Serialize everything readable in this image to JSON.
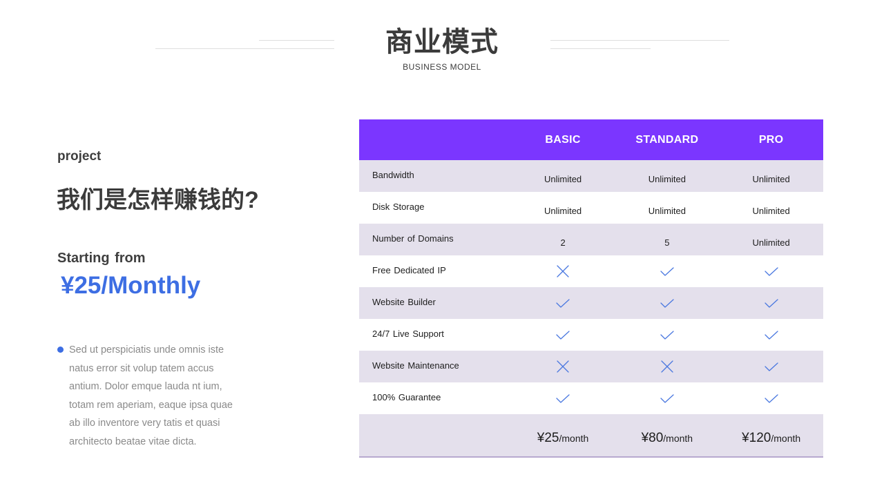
{
  "header": {
    "title": "商业模式",
    "subtitle": "BUSINESS  MODEL"
  },
  "left": {
    "project_label": "project",
    "heading": "我们是怎样赚钱的?",
    "starting_label": "Starting from",
    "price": "¥25/Monthly",
    "body": "Sed ut perspiciatis unde omnis iste natus error sit volup tatem accus antium. Dolor emque lauda nt ium, totam rem aperiam, eaque ipsa quae ab illo inventore very tatis et quasi architecto beatae vitae dicta.",
    "accent_color": "#3d6ee3"
  },
  "table": {
    "header_color": "#7b36ff",
    "shade_color": "#e4e0ec",
    "plans": [
      "BASIC",
      "STANDARD",
      "PRO"
    ],
    "rows": [
      {
        "feature": "Bandwidth",
        "values": [
          {
            "type": "text",
            "text": "Unlimited"
          },
          {
            "type": "text",
            "text": "Unlimited"
          },
          {
            "type": "text",
            "text": "Unlimited"
          }
        ]
      },
      {
        "feature": "Disk Storage",
        "values": [
          {
            "type": "text",
            "text": "Unlimited"
          },
          {
            "type": "text",
            "text": "Unlimited"
          },
          {
            "type": "text",
            "text": "Unlimited"
          }
        ]
      },
      {
        "feature": "Number  of Domains",
        "values": [
          {
            "type": "text",
            "text": "2"
          },
          {
            "type": "text",
            "text": "5"
          },
          {
            "type": "text",
            "text": "Unlimited"
          }
        ]
      },
      {
        "feature": "Free Dedicated IP",
        "values": [
          {
            "type": "cross-icon"
          },
          {
            "type": "check-icon"
          },
          {
            "type": "check-icon"
          }
        ]
      },
      {
        "feature": "Website Builder",
        "values": [
          {
            "type": "check-icon"
          },
          {
            "type": "check-icon"
          },
          {
            "type": "check-icon"
          }
        ]
      },
      {
        "feature": "24/7 Live  Support",
        "values": [
          {
            "type": "check-icon"
          },
          {
            "type": "check-icon"
          },
          {
            "type": "check-icon"
          }
        ]
      },
      {
        "feature": "Website Maintenance",
        "values": [
          {
            "type": "cross-icon"
          },
          {
            "type": "cross-icon"
          },
          {
            "type": "check-icon"
          }
        ]
      },
      {
        "feature": "100% Guarantee",
        "values": [
          {
            "type": "check-icon"
          },
          {
            "type": "check-icon"
          },
          {
            "type": "check-icon"
          }
        ]
      }
    ],
    "prices": [
      {
        "amount": "¥25",
        "unit": "/month"
      },
      {
        "amount": "¥80",
        "unit": "/month"
      },
      {
        "amount": "¥120",
        "unit": "/month"
      }
    ]
  }
}
